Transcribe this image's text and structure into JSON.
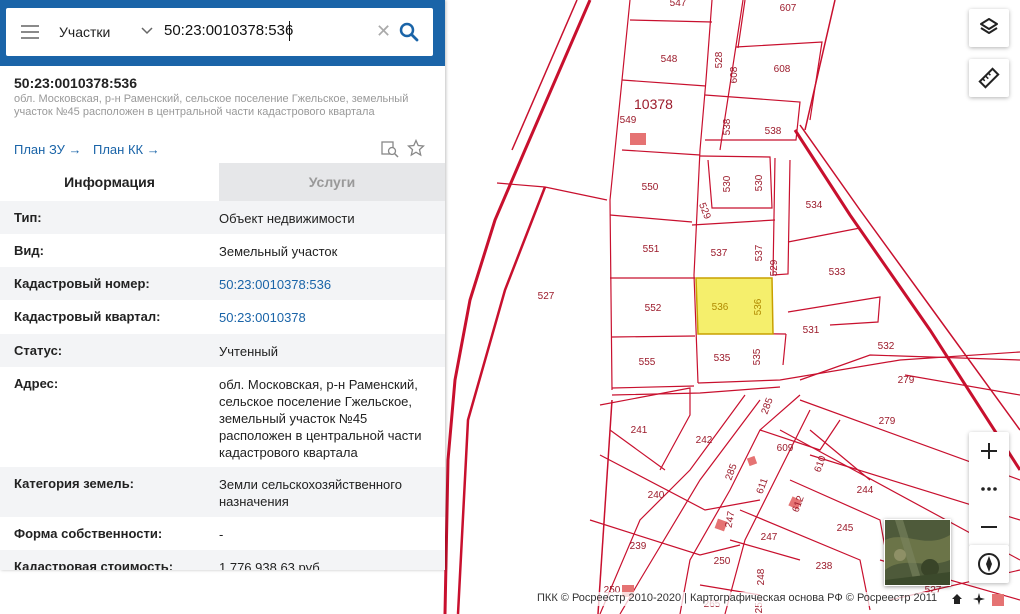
{
  "search": {
    "scope_label": "Участки",
    "query": "50:23:0010378:536"
  },
  "object": {
    "title": "50:23:0010378:536",
    "address_short": "обл. Московская, р-н Раменский, сельское поселение Гжельское, земельный участок №45 расположен в центральной части кадастрового квартала",
    "links": {
      "plan_zu": "План ЗУ →",
      "plan_kk": "План КК →"
    }
  },
  "tabs": {
    "info": "Информация",
    "services": "Услуги"
  },
  "info_rows": [
    {
      "label": "Тип:",
      "value": "Объект недвижимости"
    },
    {
      "label": "Вид:",
      "value": "Земельный участок"
    },
    {
      "label": "Кадастровый номер:",
      "value": "50:23:0010378:536"
    },
    {
      "label": "Кадастровый квартал:",
      "value": "50:23:0010378"
    },
    {
      "label": "Статус:",
      "value": "Учтенный"
    },
    {
      "label": "Адрес:",
      "value": "обл. Московская, р-н Раменский, сельское поселение Гжельское, земельный участок №45 расположен в центральной части кадастрового квартала"
    },
    {
      "label": "Категория земель:",
      "value": "Земли сельскохозяйственного назначения"
    },
    {
      "label": "Форма собственности:",
      "value": "-"
    },
    {
      "label": "Кадастровая стоимость:",
      "value": "1 776 938,63 руб."
    }
  ],
  "map": {
    "quarter_label": "10378",
    "plot_labels": [
      "547",
      "607",
      "548",
      "528",
      "608",
      "608",
      "549",
      "538",
      "538",
      "550",
      "530",
      "530",
      "534",
      "529",
      "551",
      "537",
      "537",
      "529",
      "533",
      "527",
      "552",
      "536",
      "536",
      "531",
      "555",
      "535",
      "535",
      "532",
      "279",
      "285",
      "241",
      "242",
      "609",
      "279",
      "610",
      "611",
      "285",
      "240",
      "244",
      "612",
      "247",
      "245",
      "239",
      "247",
      "250",
      "248",
      "238",
      "250",
      "251",
      "265",
      "527"
    ],
    "highlight_color": "#f5ef6c",
    "boundary_color": "#c8102e"
  },
  "attribution": "ПКК © Росреестр 2010-2020 | Картографическая основа РФ © Росреестр 2011"
}
